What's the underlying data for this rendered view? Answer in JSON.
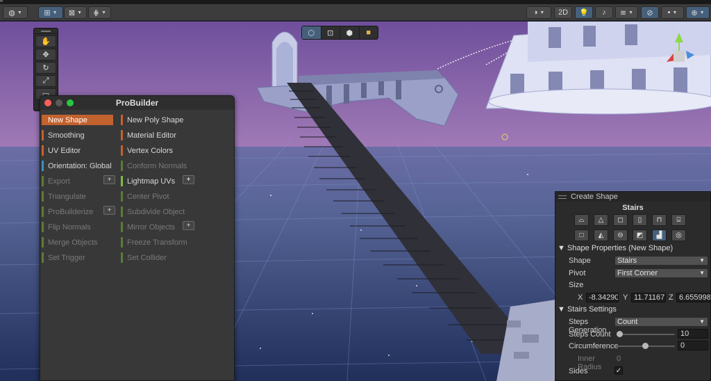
{
  "toolbar": {
    "global_icon": "globe-icon",
    "pivot_icon": "pivot-icon",
    "grid_snap_icon": "grid-snap-icon",
    "increment_icon": "increment-snap-icon",
    "view_2d": "2D"
  },
  "scene": {
    "tools": [
      "hand-icon",
      "move-icon",
      "rotate-icon",
      "scale-icon",
      "rect-icon"
    ],
    "select_modes": [
      "object-mode-icon",
      "vertex-mode-icon",
      "edge-mode-icon",
      "face-mode-icon"
    ],
    "gizmo_colors": {
      "x": "#d94343",
      "y": "#8dd94a",
      "z": "#4a8dd9"
    }
  },
  "probuilder": {
    "title": "ProBuilder",
    "buttons": {
      "new_shape": "New Shape",
      "new_poly_shape": "New Poly Shape",
      "smoothing": "Smoothing",
      "material_editor": "Material Editor",
      "uv_editor": "UV Editor",
      "vertex_colors": "Vertex Colors",
      "orientation": "Orientation: Global",
      "conform_normals": "Conform Normals",
      "export": "Export",
      "lightmap_uvs": "Lightmap UVs",
      "triangulate": "Triangulate",
      "center_pivot": "Center Pivot",
      "probuilderize": "ProBuilderize",
      "subdivide_object": "Subdivide Object",
      "flip_normals": "Flip Normals",
      "mirror_objects": "Mirror Objects",
      "merge_objects": "Merge Objects",
      "freeze_transform": "Freeze Transform",
      "set_trigger": "Set Trigger",
      "set_collider": "Set Collider"
    },
    "plus": "+"
  },
  "create_shape": {
    "header": "Create Shape",
    "shape_name": "Stairs",
    "shape_properties_title": "Shape Properties (New Shape)",
    "shape_label": "Shape",
    "shape_value": "Stairs",
    "pivot_label": "Pivot",
    "pivot_value": "First Corner",
    "size_label": "Size",
    "x_label": "X",
    "x_value": "-8.34290",
    "y_label": "Y",
    "y_value": "11.71167",
    "z_label": "Z",
    "z_value": "6.655998",
    "stairs_settings_title": "Stairs Settings",
    "steps_generation_label": "Steps Generation",
    "steps_generation_value": "Count",
    "steps_count_label": "Steps Count",
    "steps_count_value": "10",
    "steps_count_fraction": 0.05,
    "circumference_label": "Circumference",
    "circumference_value": "0",
    "inner_radius_label": "Inner Radius",
    "inner_radius_value": "0",
    "sides_label": "Sides",
    "sides_check": "✓"
  }
}
